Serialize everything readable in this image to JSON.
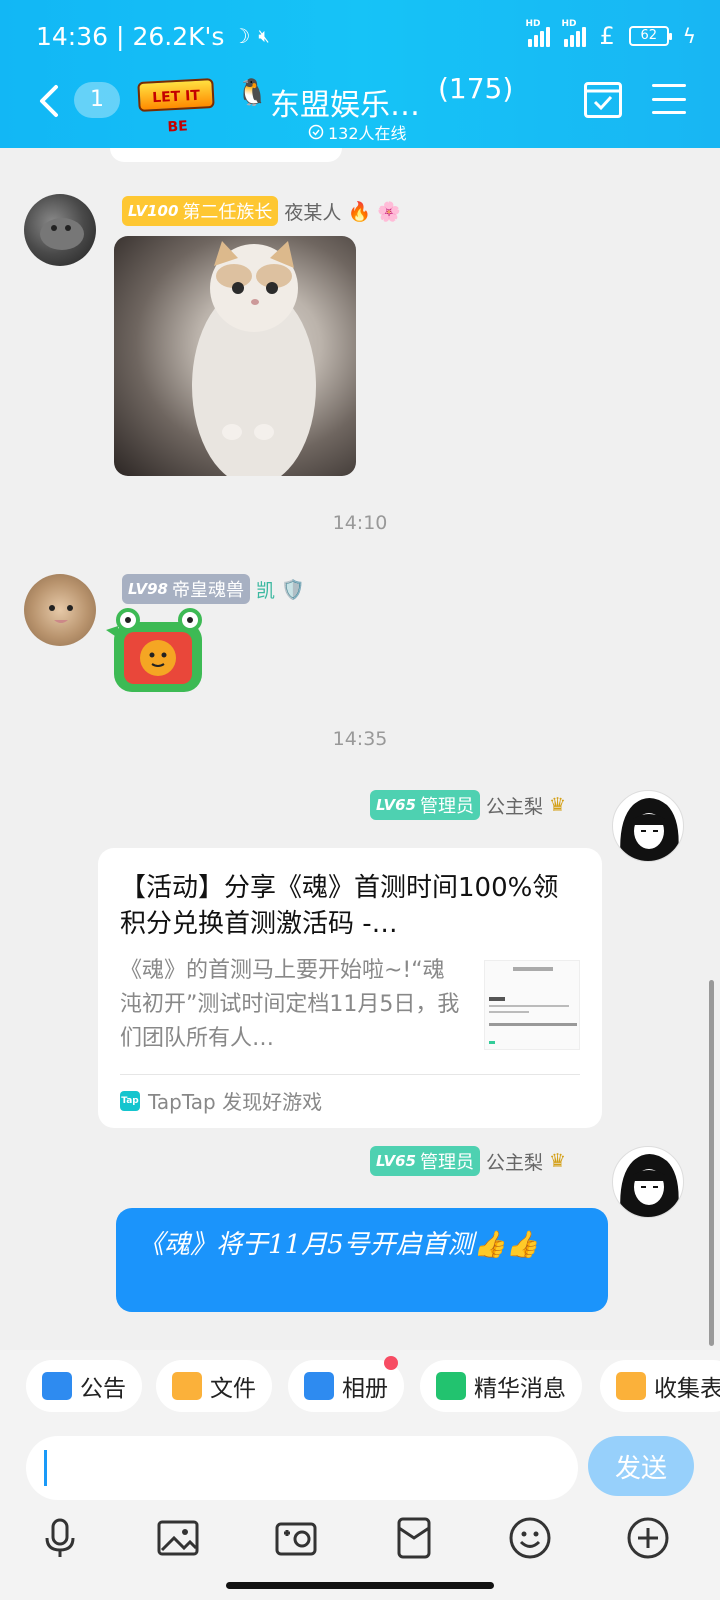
{
  "status": {
    "time": "14:36",
    "speed": "26.2K's",
    "battery": "62"
  },
  "nav": {
    "unread_count": "1",
    "logo_text": "LET IT BE",
    "group_name": "东盟娱乐…",
    "member_count": "(175)",
    "online_text": "132人在线"
  },
  "messages": [
    {
      "sender": "夜某人",
      "level": "LV100",
      "title": "第二任族长",
      "type": "image"
    },
    {
      "timestamp": "14:10"
    },
    {
      "sender": "凯",
      "level": "LV98",
      "title": "帝皇魂兽",
      "type": "sticker"
    },
    {
      "timestamp": "14:35"
    },
    {
      "sender": "公主梨",
      "level": "LV65",
      "title": "管理员",
      "type": "link-card",
      "card": {
        "title": "【活动】分享《魂》首测时间100%领积分兑换首测激活码 -…",
        "description": "《魂》的首测马上要开始啦~!“魂沌初开”测试时间定档11月5日，我们团队所有人…",
        "source": "TapTap 发现好游戏",
        "source_icon_text": "Tap"
      }
    },
    {
      "sender": "公主梨",
      "level": "LV65",
      "title": "管理员",
      "type": "text",
      "text": "《魂》将于11月5号开启首测👍👍"
    }
  ],
  "shortcuts": [
    {
      "label": "公告",
      "color": "#2e8bf0"
    },
    {
      "label": "文件",
      "color": "#fbb13a"
    },
    {
      "label": "相册",
      "color": "#2e8bf0"
    },
    {
      "label": "精华消息",
      "color": "#22c36f"
    },
    {
      "label": "收集表",
      "color": "#fbb13a"
    }
  ],
  "input": {
    "placeholder": "",
    "send_label": "发送"
  },
  "colors": {
    "header": "#12b7f5",
    "bubble_blue": "#1b94fb",
    "send_button": "#97d0fb"
  }
}
